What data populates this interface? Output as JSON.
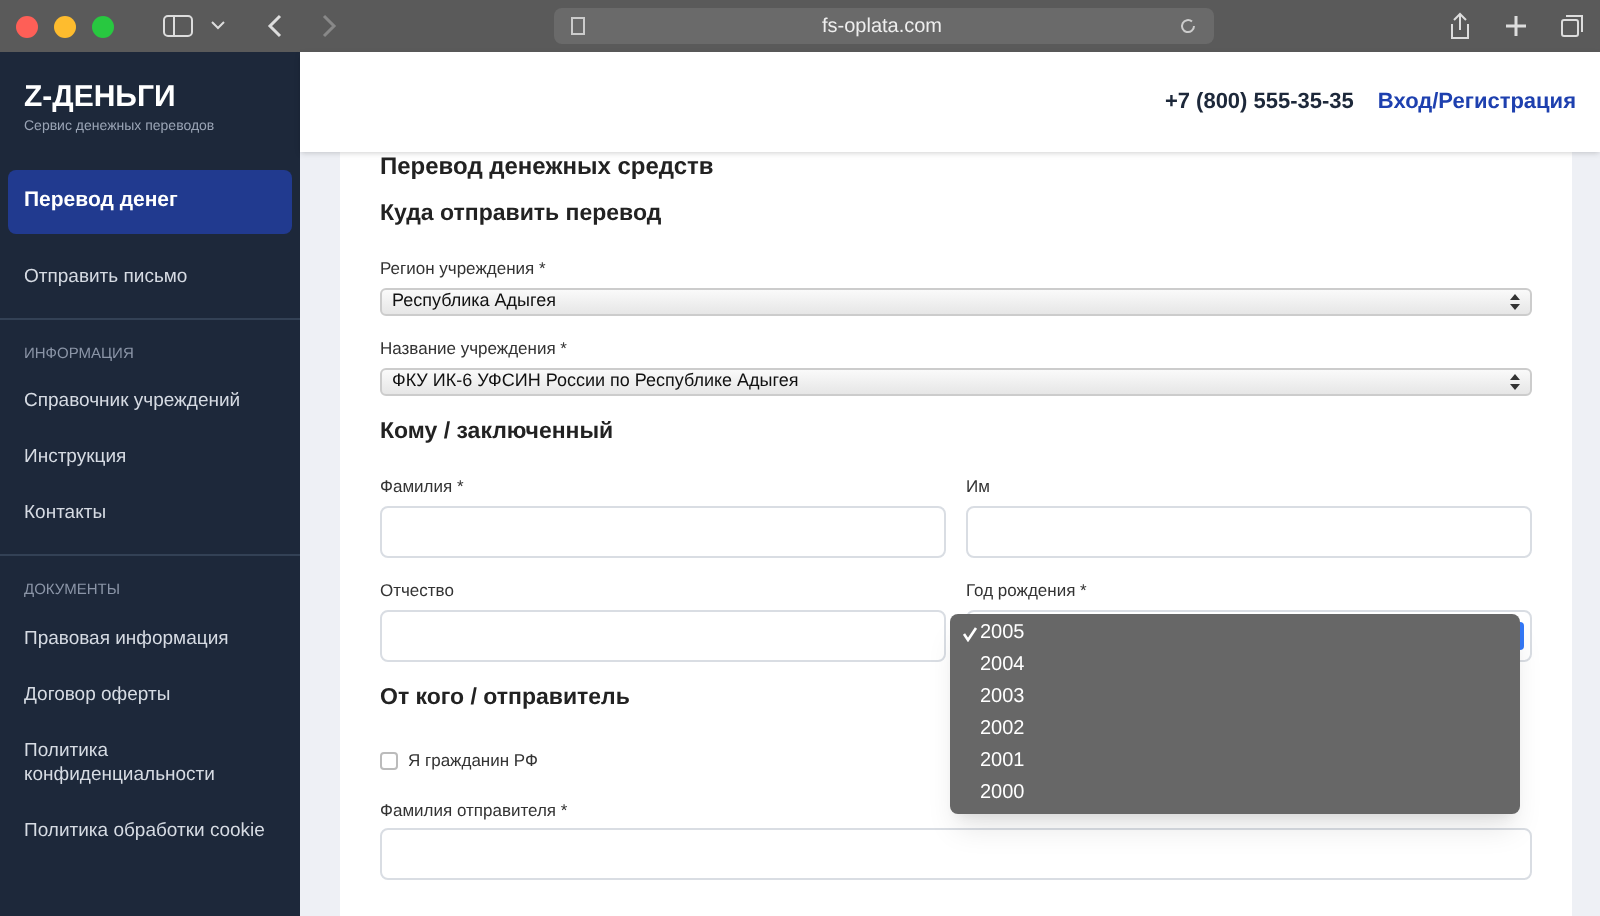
{
  "browser": {
    "url": "fs-oplata.com"
  },
  "sidebar": {
    "brand": "Z-ДЕНЬГИ",
    "tagline": "Сервис денежных переводов",
    "items": [
      {
        "kind": "link",
        "label": "Перевод денег",
        "selected": true
      },
      {
        "kind": "link",
        "label": "Отправить письмо",
        "selected": false
      },
      {
        "kind": "section",
        "label": "ИНФОРМАЦИЯ"
      },
      {
        "kind": "link",
        "label": "Справочник учреждений",
        "selected": false
      },
      {
        "kind": "link",
        "label": "Инструкция",
        "selected": false
      },
      {
        "kind": "link",
        "label": "Контакты",
        "selected": false
      },
      {
        "kind": "section",
        "label": "ДОКУМЕНТЫ"
      },
      {
        "kind": "link",
        "label": "Правовая информация",
        "selected": false
      },
      {
        "kind": "link",
        "label": "Договор оферты",
        "selected": false
      },
      {
        "kind": "link",
        "label": "Политика конфиденциальности",
        "selected": false
      },
      {
        "kind": "link",
        "label": "Политика обработки cookie",
        "selected": false
      }
    ]
  },
  "header": {
    "phone": "+7 (800) 555-35-35",
    "login": "Вход/Регистрация"
  },
  "form": {
    "title": "Перевод денежных средств",
    "sections": [
      {
        "title": "Куда отправить перевод",
        "rows": [
          [
            {
              "kind": "select",
              "label": "Регион учреждения *",
              "value": "Республика Адыгея"
            }
          ],
          [
            {
              "kind": "select",
              "label": "Название учреждения *",
              "value": "ФКУ ИК-6 УФСИН России по Республике Адыгея"
            }
          ]
        ]
      },
      {
        "title": "Кому / заключенный",
        "rows": [
          [
            {
              "kind": "text",
              "label": "Фамилия *"
            },
            {
              "kind": "text",
              "label": "Им"
            }
          ],
          [
            {
              "kind": "text",
              "label": "Отчество"
            },
            {
              "kind": "dropdown",
              "label": "Год рождения *",
              "options": [
                {
                  "label": "2005",
                  "selected": true
                },
                {
                  "label": "2004",
                  "selected": false
                },
                {
                  "label": "2003",
                  "selected": false
                },
                {
                  "label": "2002",
                  "selected": false
                },
                {
                  "label": "2001",
                  "selected": false
                },
                {
                  "label": "2000",
                  "selected": false
                }
              ]
            }
          ]
        ]
      },
      {
        "title": "От кого / отправитель",
        "rows": [
          [
            {
              "kind": "checkbox",
              "label": "Я гражданин РФ",
              "checked": false
            }
          ],
          [
            {
              "kind": "text",
              "label": "Фамилия отправителя *"
            }
          ]
        ]
      }
    ]
  }
}
